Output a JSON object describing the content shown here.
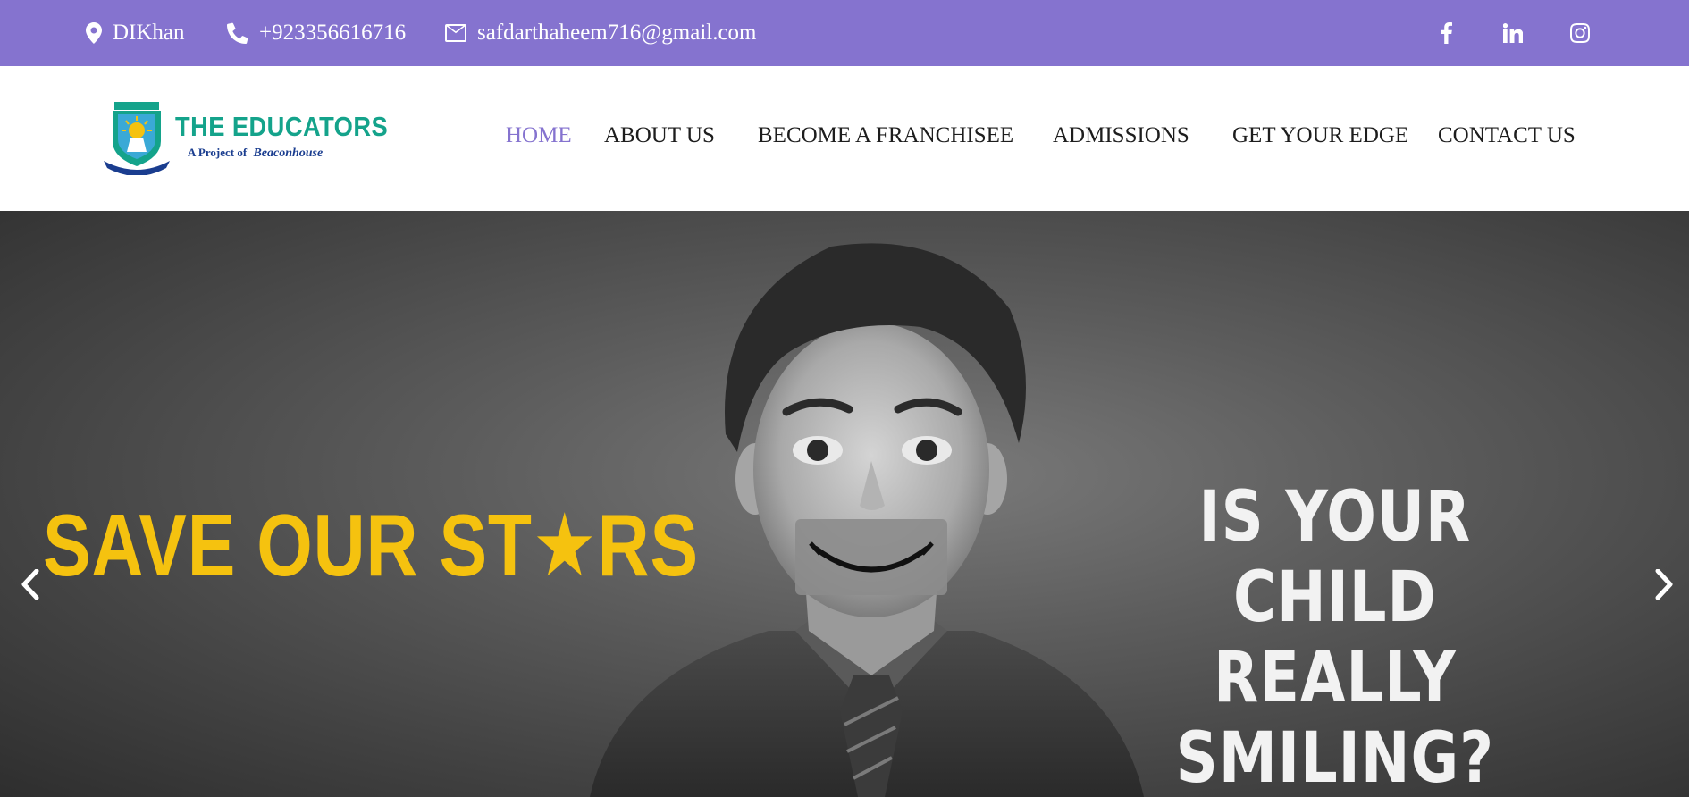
{
  "topbar": {
    "location": "DIKhan",
    "phone": "+923356616716",
    "email": "safdarthaheem716@gmail.com",
    "social": [
      {
        "icon": "facebook-icon"
      },
      {
        "icon": "linkedin-icon"
      },
      {
        "icon": "instagram-icon"
      }
    ]
  },
  "header": {
    "logo": {
      "title": "THE EDUCATORS",
      "subtitle_prefix": "A Project of",
      "subtitle_brand": "Beaconhouse"
    },
    "nav": [
      {
        "label": "HOME",
        "active": true
      },
      {
        "label": "ABOUT US",
        "active": false
      },
      {
        "label": "BECOME A FRANCHISEE",
        "active": false
      },
      {
        "label": "ADMISSIONS",
        "active": false
      },
      {
        "label": "GET YOUR EDGE",
        "active": false
      },
      {
        "label": "CONTACT US",
        "active": false
      }
    ]
  },
  "hero": {
    "headline_left": "SAVE OUR ST★RS",
    "headline_right_line1": "IS YOUR CHILD",
    "headline_right_line2": "REALLY SMILING?"
  },
  "colors": {
    "topbar_bg": "#8573cf",
    "nav_active": "#8573cf",
    "brand_green": "#14a38b",
    "brand_blue": "#1a3d8f",
    "headline_yellow": "#f5c20f"
  }
}
